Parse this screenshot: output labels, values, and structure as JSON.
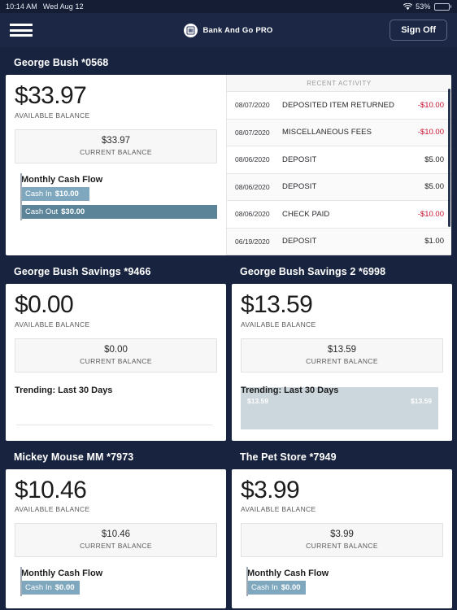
{
  "status_bar": {
    "time": "10:14 AM",
    "date": "Wed Aug 12",
    "battery_percent": "53%",
    "wifi_icon": "wifi-icon",
    "battery_icon": "battery-icon"
  },
  "nav": {
    "menu_icon": "hamburger-menu-icon",
    "logo_icon": "bank-logo-icon",
    "brand": "Bank And Go PRO",
    "sign_off": "Sign Off"
  },
  "labels": {
    "available_balance": "AVAILABLE BALANCE",
    "current_balance": "CURRENT BALANCE",
    "monthly_cash_flow": "Monthly Cash Flow",
    "trending": "Trending: Last 30 Days",
    "cash_in": "Cash In",
    "cash_out": "Cash Out",
    "recent_activity": "RECENT ACTIVITY"
  },
  "colors": {
    "background": "#18243f",
    "navbar": "#1b2745",
    "card": "#ffffff",
    "cash_in_bar": "#7fa8bf",
    "cash_out_bar": "#5b8499",
    "negative_amount": "#c8102e",
    "trend_fill": "#ccd6dd"
  },
  "accounts": [
    {
      "title": "George Bush *0568",
      "available_balance": "$33.97",
      "current_balance": "$33.97",
      "cash_in": "$10.00",
      "cash_out": "$30.00",
      "cash_in_width_pct": 35,
      "cash_out_width_pct": 100
    },
    {
      "title": "George Bush Savings *9466",
      "available_balance": "$0.00",
      "current_balance": "$0.00",
      "trend_label_left": "",
      "trend_label_right": ""
    },
    {
      "title": "George Bush Savings 2 *6998",
      "available_balance": "$13.59",
      "current_balance": "$13.59",
      "trend_label_left": "$13.59",
      "trend_label_right": "$13.59"
    },
    {
      "title": "Mickey Mouse MM *7973",
      "available_balance": "$10.46",
      "current_balance": "$10.46",
      "cash_in": "$0.00"
    },
    {
      "title": "The Pet Store *7949",
      "available_balance": "$3.99",
      "current_balance": "$3.99",
      "cash_in": "$0.00"
    }
  ],
  "recent_activity": [
    {
      "date": "08/07/2020",
      "description": "DEPOSITED ITEM RETURNED",
      "amount": "-$10.00",
      "negative": true
    },
    {
      "date": "08/07/2020",
      "description": "MISCELLANEOUS FEES",
      "amount": "-$10.00",
      "negative": true
    },
    {
      "date": "08/06/2020",
      "description": "DEPOSIT",
      "amount": "$5.00",
      "negative": false
    },
    {
      "date": "08/06/2020",
      "description": "DEPOSIT",
      "amount": "$5.00",
      "negative": false
    },
    {
      "date": "08/06/2020",
      "description": "CHECK PAID",
      "amount": "-$10.00",
      "negative": true
    },
    {
      "date": "06/19/2020",
      "description": "DEPOSIT",
      "amount": "$1.00",
      "negative": false
    }
  ]
}
